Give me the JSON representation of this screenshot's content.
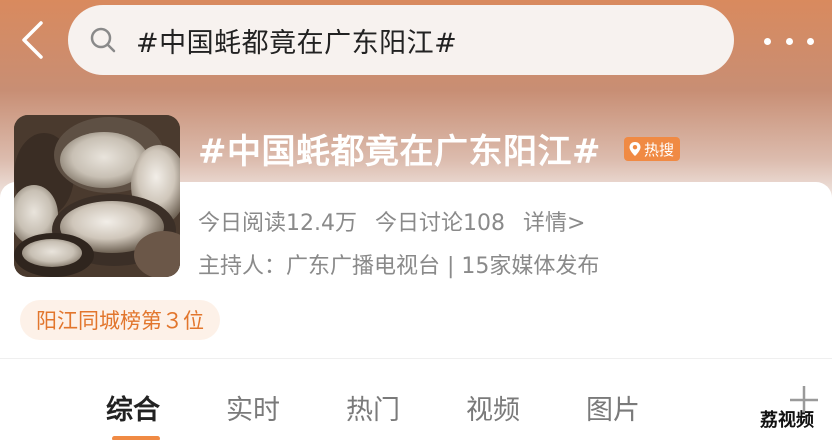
{
  "header": {
    "search_query": "#中国蚝都竟在广东阳江#",
    "colors": {
      "gradient_top": "#d98a5e",
      "gradient_bottom": "#f2e9e5"
    }
  },
  "topic": {
    "title": "#中国蚝都竟在广东阳江#",
    "hot_badge": "热搜",
    "reads": "今日阅读12.4万",
    "discussions": "今日讨论108",
    "detail_link": "详情>",
    "host": "主持人：广东广播电视台 | 15家媒体发布",
    "rank": "阳江同城榜第３位"
  },
  "tabs": [
    {
      "label": "综合",
      "active": true
    },
    {
      "label": "实时",
      "active": false
    },
    {
      "label": "热门",
      "active": false
    },
    {
      "label": "视频",
      "active": false
    },
    {
      "label": "图片",
      "active": false
    }
  ],
  "watermark": "荔视频",
  "accent_color": "#f08a44"
}
